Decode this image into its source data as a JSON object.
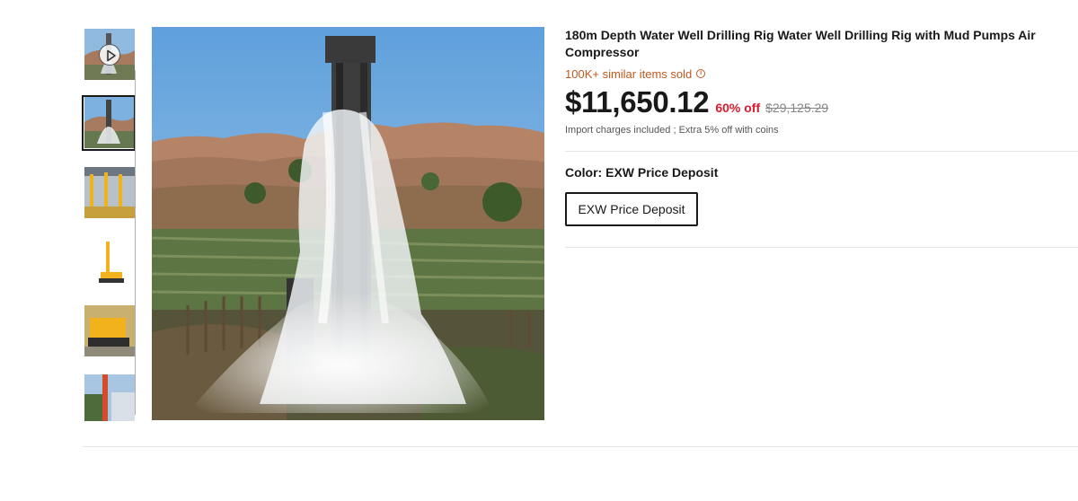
{
  "product": {
    "title": "180m Depth Water Well Drilling Rig Water Well Drilling Rig with Mud Pumps Air Compressor",
    "sold_text": "100K+ similar items sold",
    "price": "$11,650.12",
    "discount": "60% off",
    "original_price": "$29,125.29",
    "charges_note": "Import charges included ; Extra 5% off with coins",
    "color_label": "Color: EXW Price Deposit",
    "color_option": "EXW Price Deposit"
  },
  "gallery": {
    "selected_index": 1,
    "thumbnails": [
      {
        "icon": "play-icon",
        "subject": "drilling-rig-video"
      },
      {
        "subject": "water-gushing-rig"
      },
      {
        "subject": "yellow-rigs-warehouse"
      },
      {
        "subject": "yellow-rig-white-background"
      },
      {
        "subject": "yellow-crawler-rig"
      },
      {
        "subject": "rig-on-site"
      }
    ]
  },
  "colors": {
    "text": "#191919",
    "sold": "#c05a1d",
    "discount": "#e0182e",
    "muted": "#858585",
    "rig_yellow": "#f2b21b"
  }
}
